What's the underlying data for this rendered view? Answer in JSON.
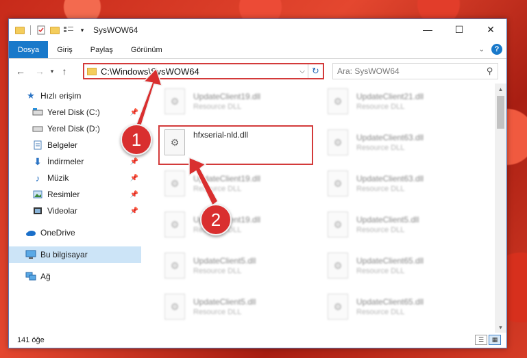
{
  "window": {
    "title": "SysWOW64"
  },
  "ribbon": {
    "tabs": [
      "Dosya",
      "Giriş",
      "Paylaş",
      "Görünüm"
    ]
  },
  "address": {
    "path": "C:\\Windows\\SysWOW64"
  },
  "search": {
    "placeholder": "Ara: SysWOW64"
  },
  "sidebar": {
    "items": [
      {
        "label": "Hızlı erişim",
        "icon": "star-icon"
      },
      {
        "label": "Yerel Disk (C:)",
        "icon": "drive-icon",
        "pinned": true
      },
      {
        "label": "Yerel Disk (D:)",
        "icon": "drive-icon",
        "pinned": false
      },
      {
        "label": "Belgeler",
        "icon": "documents-icon",
        "pinned": true
      },
      {
        "label": "İndirmeler",
        "icon": "download-icon",
        "pinned": true
      },
      {
        "label": "Müzik",
        "icon": "music-icon",
        "pinned": true
      },
      {
        "label": "Resimler",
        "icon": "pictures-icon",
        "pinned": true
      },
      {
        "label": "Videolar",
        "icon": "video-icon",
        "pinned": true
      },
      {
        "label": "OneDrive",
        "icon": "cloud-icon"
      },
      {
        "label": "Bu bilgisayar",
        "icon": "computer-icon",
        "selected": true
      },
      {
        "label": "Ağ",
        "icon": "network-icon"
      }
    ]
  },
  "files": {
    "col1": [
      {
        "name": "UpdateClient19.dll",
        "type": "Resource DLL"
      },
      {
        "name": "hfxserial-nld.dll",
        "type": ""
      },
      {
        "name": "UpdateClient19.dll",
        "type": "Resource DLL"
      },
      {
        "name": "UpdateClient19.dll",
        "type": "Resource DLL"
      },
      {
        "name": "UpdateClient5.dll",
        "type": "Resource DLL"
      },
      {
        "name": "UpdateClient5.dll",
        "type": "Resource DLL"
      }
    ],
    "col2": [
      {
        "name": "UpdateClient21.dll",
        "type": "Resource DLL"
      },
      {
        "name": "UpdateClient63.dll",
        "type": "Resource DLL"
      },
      {
        "name": "UpdateClient63.dll",
        "type": "Resource DLL"
      },
      {
        "name": "UpdateClient5.dll",
        "type": "Resource DLL"
      },
      {
        "name": "UpdateClient65.dll",
        "type": "Resource DLL"
      },
      {
        "name": "UpdateClient65.dll",
        "type": "Resource DLL"
      }
    ]
  },
  "status": {
    "count": "141 öğe"
  },
  "annotations": {
    "badge1": "1",
    "badge2": "2"
  },
  "colors": {
    "accent": "#1979ca",
    "annotation": "#d92f2f"
  }
}
